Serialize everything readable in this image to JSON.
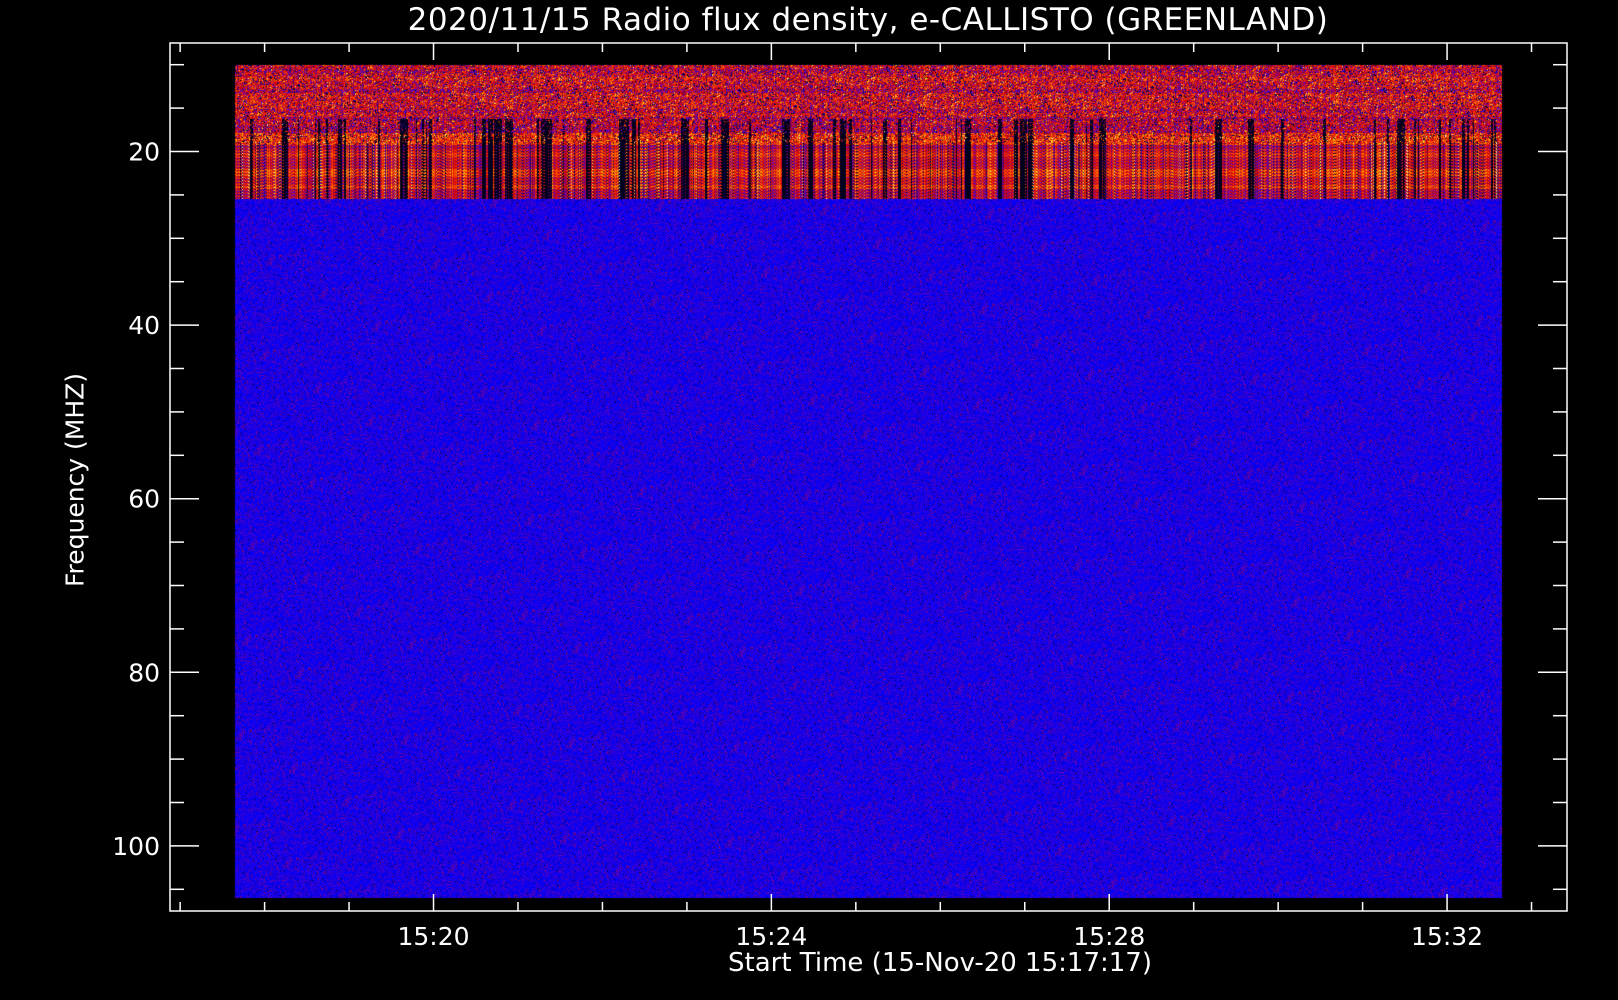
{
  "chart_data": {
    "type": "heatmap",
    "title": "2020/11/15  Radio flux density, e-CALLISTO (GREENLAND)",
    "xlabel": "Start Time (15-Nov-20 15:17:17)",
    "ylabel": "Frequency (MHZ)",
    "x_units": "minutes after 15:00 UT",
    "xlim": [
      16.88,
      33.42
    ],
    "ylim": [
      107.5,
      7.5
    ],
    "y_inverted": true,
    "x_major_ticks": [
      20,
      24,
      28,
      32
    ],
    "x_tick_labels": [
      "15:20",
      "15:24",
      "15:28",
      "15:32"
    ],
    "x_minor_step": 1,
    "y_major_ticks": [
      20,
      40,
      60,
      80,
      100
    ],
    "y_tick_labels": [
      "20",
      "40",
      "60",
      "80",
      "100"
    ],
    "y_minor_step": 5,
    "data_time_range": [
      17.65,
      32.65
    ],
    "data_freq_range": [
      10,
      106
    ],
    "emission_band_mhz": [
      10,
      25.5
    ],
    "emission_level": "high",
    "background_level": "low",
    "colormap": [
      "#000000",
      "#0000ff",
      "#6a00a8",
      "#d40000",
      "#ff5000",
      "#ffe000",
      "#ffffc0"
    ],
    "grid": false
  }
}
